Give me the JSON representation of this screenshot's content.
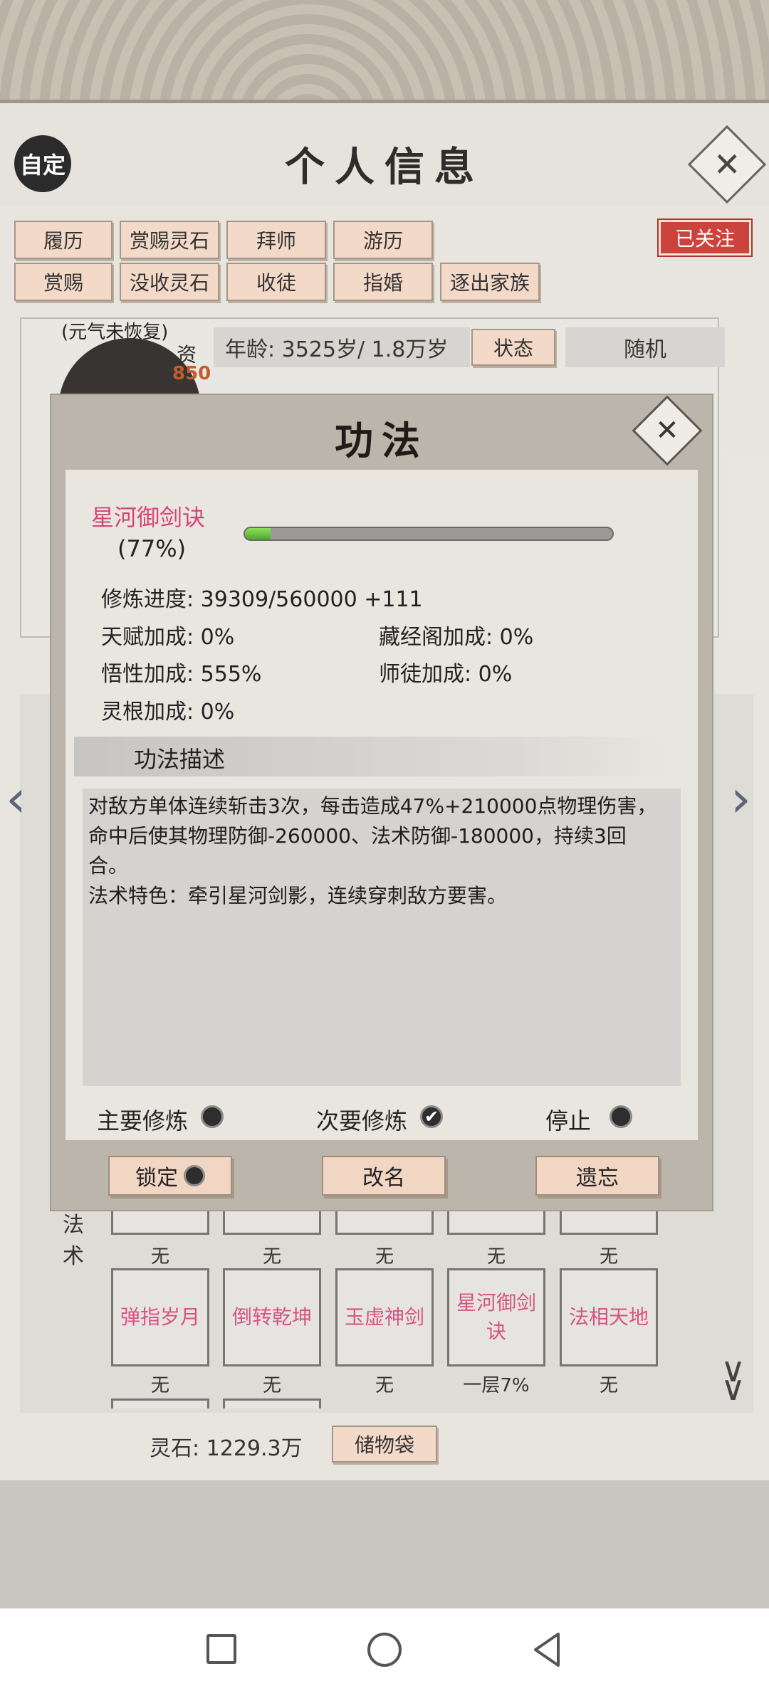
{
  "header": {
    "badge": "自定",
    "title": "个人信息",
    "close": "✕"
  },
  "actions_row1": [
    "履历",
    "赏赐灵石",
    "拜师",
    "游历"
  ],
  "actions_row2": [
    "赏赐",
    "没收灵石",
    "收徒",
    "指婚",
    "逐出家族"
  ],
  "follow": "已关注",
  "profile": {
    "status_note": "(元气未恢复)",
    "zi": "资",
    "zi_value": "850",
    "age": "年龄: 3525岁/ 1.8万岁",
    "state_btn": "状态",
    "random": "随机"
  },
  "spell_label": [
    "法",
    "术"
  ],
  "skills_row_status": [
    "无",
    "无",
    "无",
    "无",
    "无"
  ],
  "skills": [
    {
      "name": "弹指岁月",
      "status": "无"
    },
    {
      "name": "倒转乾坤",
      "status": "无"
    },
    {
      "name": "玉虚神剑",
      "status": "无"
    },
    {
      "name": "星河御剑诀",
      "status": "一层7%"
    },
    {
      "name": "法相天地",
      "status": "无"
    }
  ],
  "stones": "灵石: 1229.3万",
  "bag": "储物袋",
  "modal": {
    "title": "功法",
    "close": "✕",
    "skill_name": "星河御剑诀",
    "percent_text": "(77%)",
    "progress_fraction": 0.07,
    "cultivation": "修炼进度: 39309/560000  +111",
    "talent": "天赋加成:  0%",
    "library": "藏经阁加成: 0%",
    "wisdom": "悟性加成:  555%",
    "master": "师徒加成:   0%",
    "root": "灵根加成:  0%",
    "desc_header": "功法描述",
    "desc_line1": "对敌方单体连续斩击3次，每击造成47%+210000点物理伤害，",
    "desc_line2": "命中后使其物理防御-260000、法术防御-180000，持续3回",
    "desc_line3": "合。",
    "desc_line4": "法术特色：牵引星河剑影，连续穿刺敌方要害。",
    "primary": "主要修炼",
    "secondary": "次要修炼",
    "stop": "停止",
    "lock": "锁定",
    "rename": "改名",
    "forget": "遗忘"
  },
  "colors": {
    "accent_pink": "#d5457a",
    "follow_red": "#c8342e",
    "button_bg": "#f2d6c4",
    "progress_green": "#6cc23f"
  }
}
